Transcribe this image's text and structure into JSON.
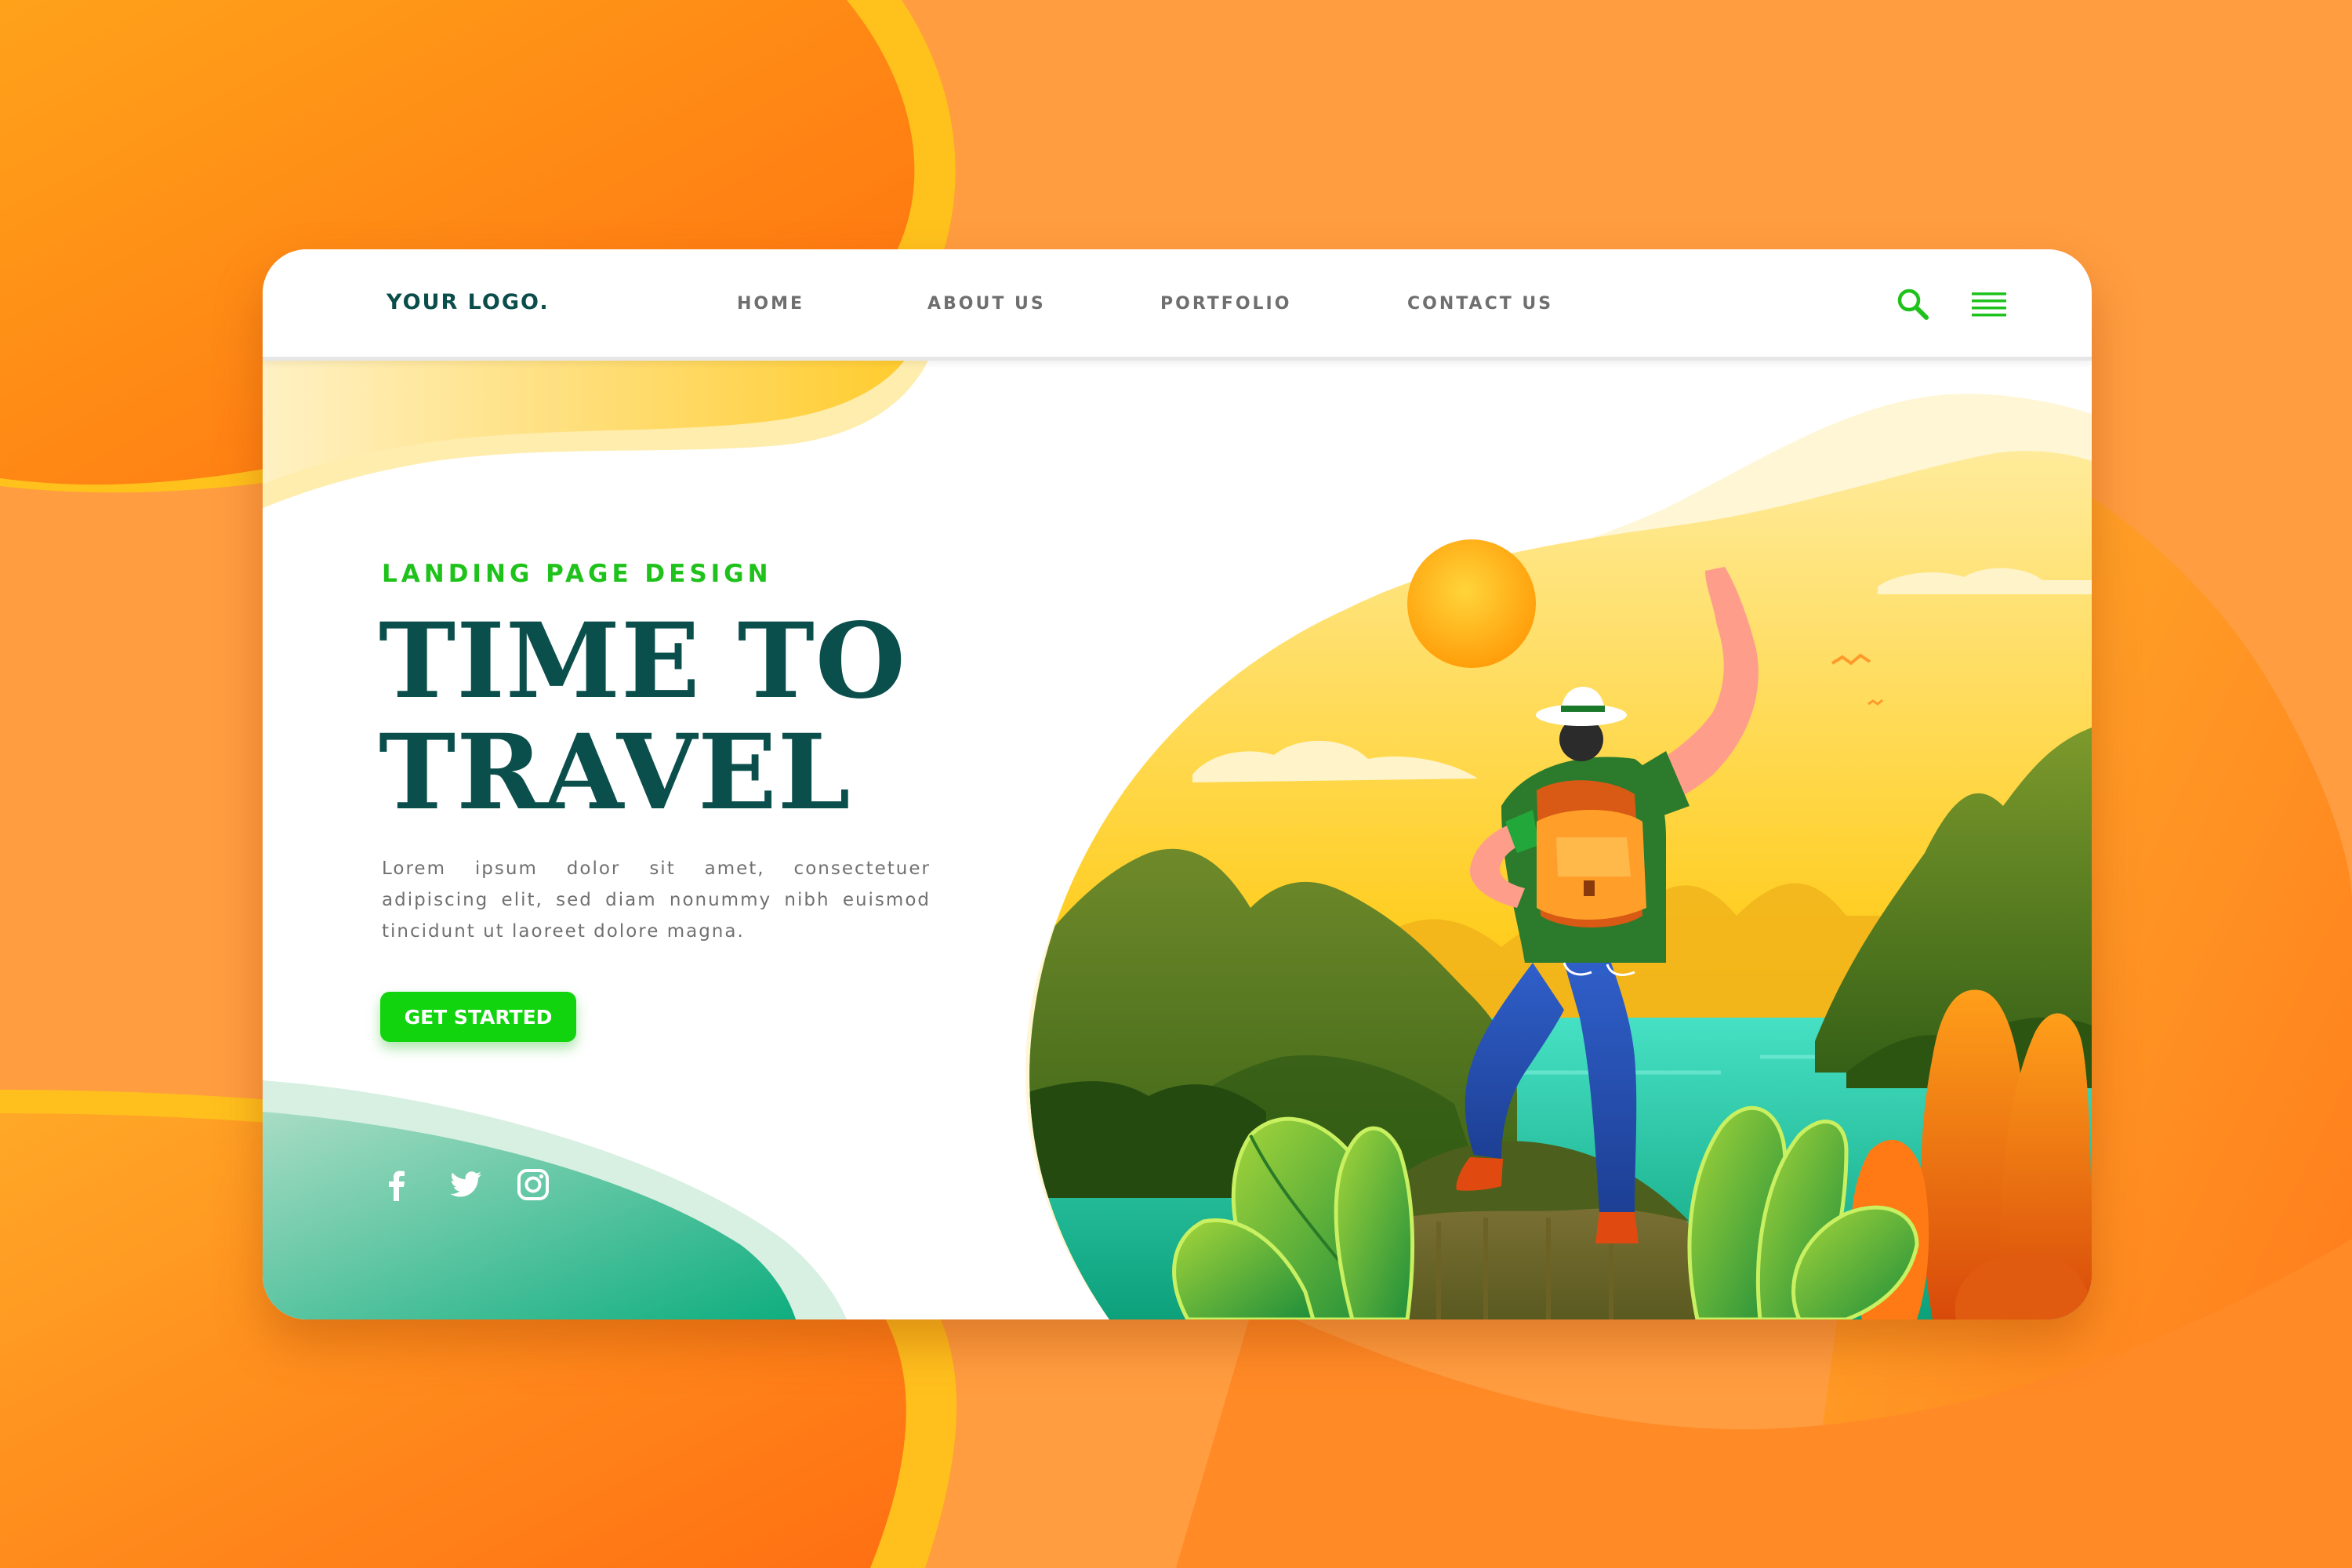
{
  "header": {
    "logo": "YOUR LOGO.",
    "nav": [
      "HOME",
      "ABOUT US",
      "PORTFOLIO",
      "CONTACT US"
    ],
    "icons": [
      "search-icon",
      "menu-icon"
    ]
  },
  "hero": {
    "eyebrow": "LANDING PAGE DESIGN",
    "title_line1": "TIME TO",
    "title_line2": "TRAVEL",
    "body": "Lorem ipsum dolor sit amet, consectetuer adipiscing elit, sed diam nonummy nibh euismod tincidunt ut laoreet dolore magna.",
    "cta_label": "GET STARTED"
  },
  "socials": [
    "facebook-icon",
    "twitter-icon",
    "instagram-icon"
  ],
  "colors": {
    "background": "#ff9a3c",
    "accent_green": "#11d40f",
    "title_teal": "#0b4f4c",
    "icon_green": "#1ec21a"
  }
}
